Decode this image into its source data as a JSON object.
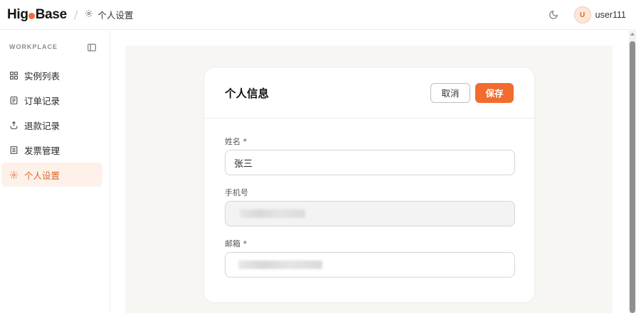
{
  "app": {
    "logo_prefix": "Hig",
    "logo_suffix": "Base",
    "breadcrumb": "个人设置",
    "username": "user111",
    "avatar_letter": "U"
  },
  "sidebar": {
    "section_label": "WORKPLACE",
    "items": [
      {
        "label": "实例列表",
        "icon": "grid-icon"
      },
      {
        "label": "订单记录",
        "icon": "document-icon"
      },
      {
        "label": "退款记录",
        "icon": "refund-icon"
      },
      {
        "label": "发票管理",
        "icon": "invoice-icon"
      },
      {
        "label": "个人设置",
        "icon": "gear-icon",
        "active": true
      }
    ]
  },
  "main": {
    "card_title": "个人信息",
    "cancel_label": "取消",
    "save_label": "保存",
    "fields": {
      "name": {
        "label": "姓名 *",
        "value": "张三"
      },
      "phone": {
        "label": "手机号"
      },
      "email": {
        "label": "邮箱 *"
      }
    }
  },
  "colors": {
    "accent": "#f26b2f",
    "active_bg": "#fdf1ea",
    "canvas_bg": "#f7f6f3"
  }
}
